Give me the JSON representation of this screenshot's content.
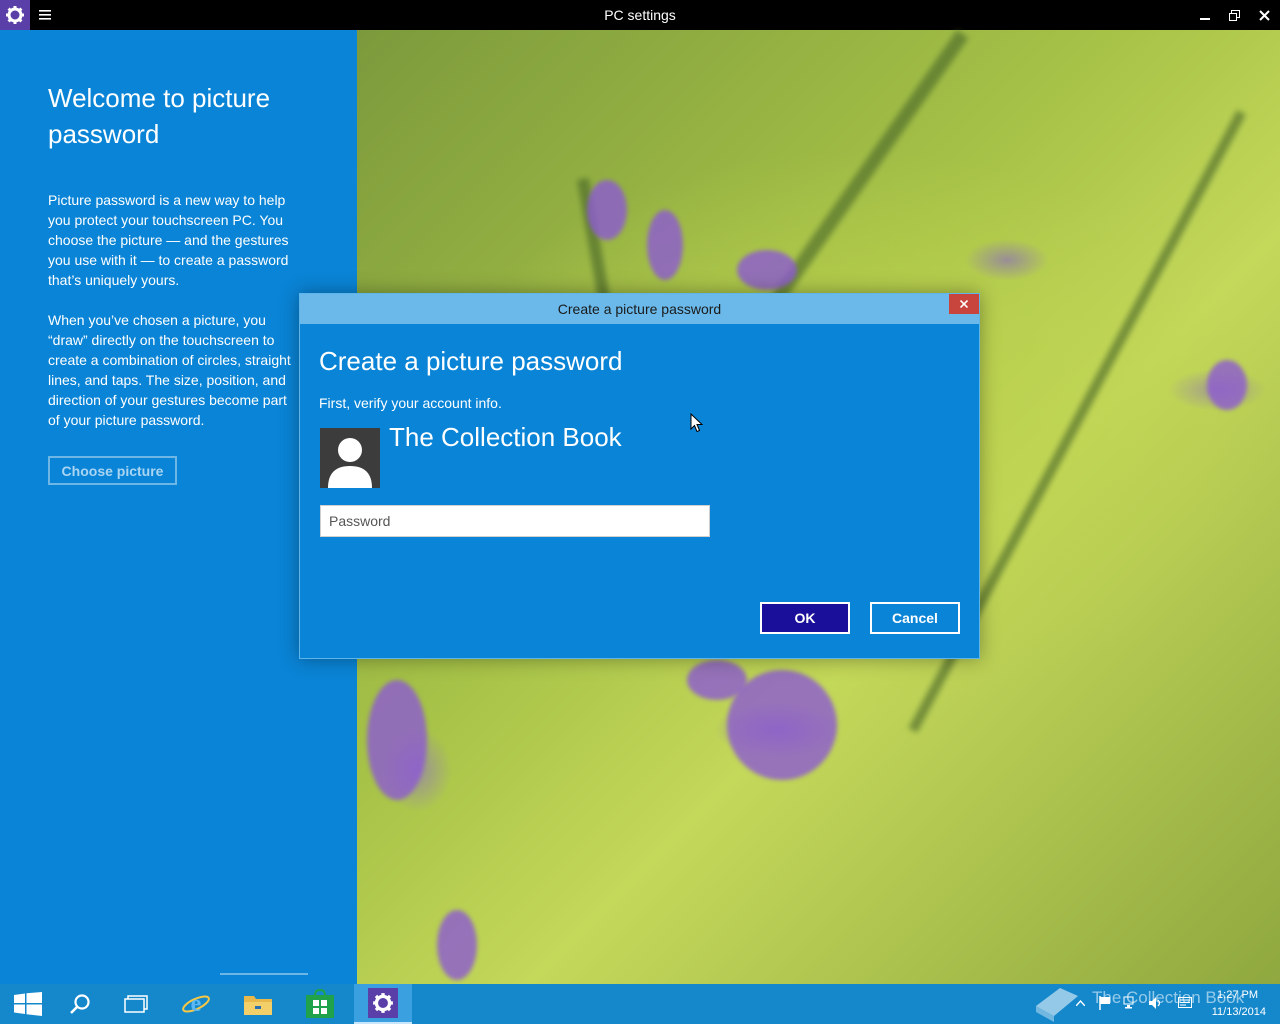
{
  "window": {
    "title": "PC settings",
    "app_icon": "gear-icon",
    "controls": [
      "minimize-icon",
      "restore-icon",
      "close-icon"
    ]
  },
  "left_panel": {
    "title": "Welcome to picture password",
    "paragraph1": "Picture password is a new way to help you protect your touchscreen PC. You choose the picture — and the gestures you use with it — to create a password that’s uniquely yours.",
    "paragraph2": "When you’ve chosen a picture, you “draw” directly on the touchscreen to create a combination of circles, straight lines, and taps. The size, position, and direction of your gestures become part of your picture password.",
    "choose_button": "Choose picture"
  },
  "dialog": {
    "window_title": "Create a picture password",
    "heading": "Create a picture password",
    "subtext": "First, verify your account info.",
    "user_name": "The Collection Book",
    "password_placeholder": "Password",
    "password_value": "",
    "ok_label": "OK",
    "cancel_label": "Cancel"
  },
  "taskbar": {
    "items": [
      {
        "icon": "windows-start-icon"
      },
      {
        "icon": "search-icon"
      },
      {
        "icon": "task-view-icon"
      },
      {
        "icon": "internet-explorer-icon"
      },
      {
        "icon": "file-explorer-icon"
      },
      {
        "icon": "store-icon"
      },
      {
        "icon": "settings-gear-icon",
        "active": true
      }
    ],
    "watermark": "The Collection Book",
    "time": "1:27 PM",
    "date": "11/13/2014"
  },
  "colors": {
    "accent_blue": "#0a84d6",
    "dialog_title_bar": "#6ab9ea",
    "ok_button": "#1a0f9a",
    "close_red": "#c8453d",
    "app_icon_purple": "#5b3fa8",
    "taskbar": "#1588cc"
  }
}
